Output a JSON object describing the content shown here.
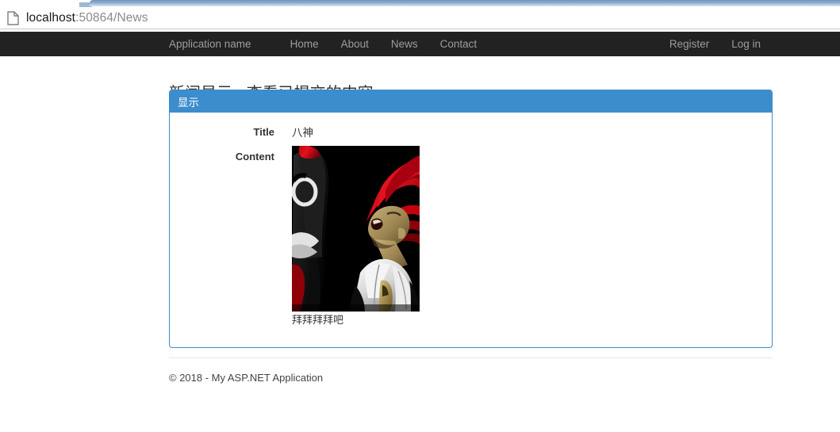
{
  "browser": {
    "page_icon": "page-document-icon",
    "url_host": "localhost",
    "url_rest": ":50864/News",
    "url_full": "localhost:50864/News"
  },
  "navbar": {
    "brand": "Application name",
    "links": [
      {
        "label": "Home"
      },
      {
        "label": "About"
      },
      {
        "label": "News"
      },
      {
        "label": "Contact"
      }
    ],
    "right_links": [
      {
        "label": "Register"
      },
      {
        "label": "Log in"
      }
    ],
    "background_color": "#222222",
    "link_color": "#9d9d9d"
  },
  "main": {
    "page_title": "新闻显示 - 查看已提交的内容",
    "panel": {
      "heading": "显示",
      "accent_color": "#3c8dcc",
      "fields": [
        {
          "label": "Title",
          "value": "八神"
        },
        {
          "label": "Content",
          "value": ""
        }
      ],
      "image_caption": "拜拜拜拜吧",
      "image_alt": "八神"
    }
  },
  "footer": {
    "text": "© 2018 - My ASP.NET Application"
  }
}
